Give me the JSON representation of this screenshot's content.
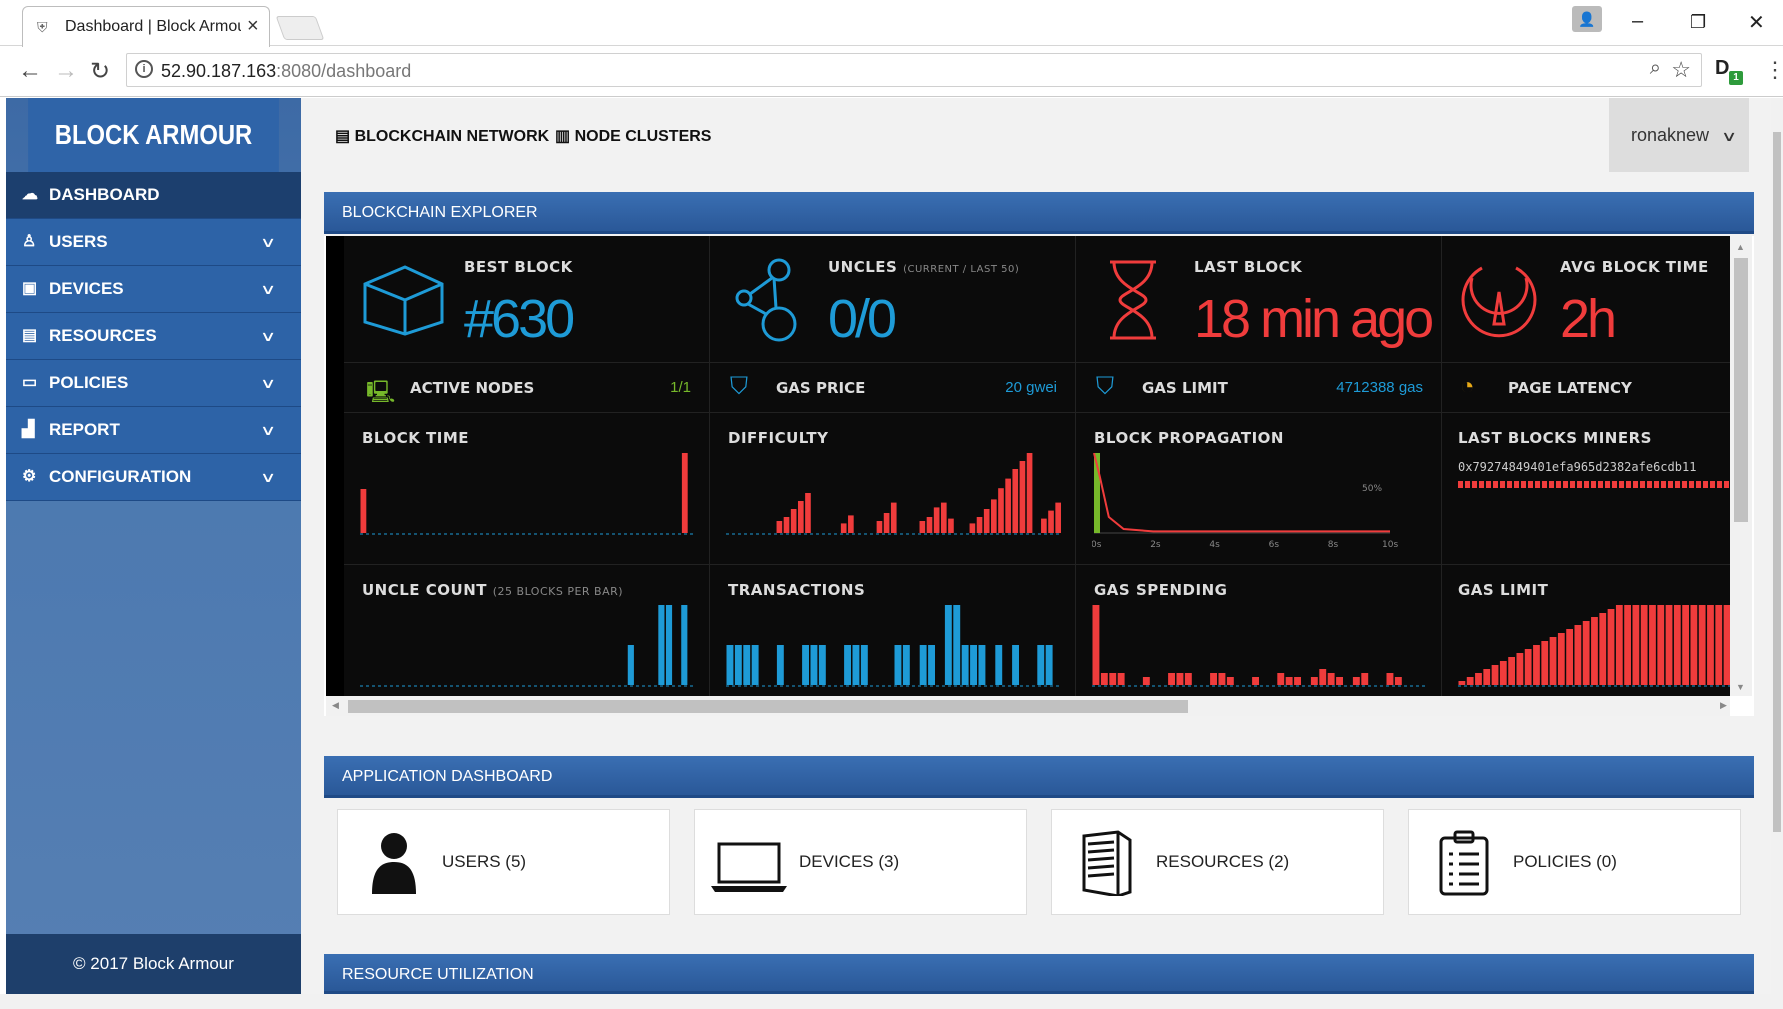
{
  "browser": {
    "tab_title": "Dashboard | Block Armour",
    "url_host": "52.90.187.163",
    "url_path": ":8080/dashboard",
    "ext_badge": "1"
  },
  "sidebar": {
    "logo": "BLOCK ARMOUR",
    "items": [
      {
        "label": "DASHBOARD",
        "icon": "dashboard-icon"
      },
      {
        "label": "USERS",
        "icon": "user-icon"
      },
      {
        "label": "DEVICES",
        "icon": "monitor-icon"
      },
      {
        "label": "RESOURCES",
        "icon": "server-icon"
      },
      {
        "label": "POLICIES",
        "icon": "policy-icon"
      },
      {
        "label": "REPORT",
        "icon": "bar-chart-icon"
      },
      {
        "label": "CONFIGURATION",
        "icon": "gear-icon"
      }
    ],
    "footer": "© 2017 Block Armour"
  },
  "topnav": {
    "blockchain_network": "BLOCKCHAIN NETWORK",
    "node_clusters": "NODE CLUSTERS",
    "username": "ronaknew"
  },
  "explorer": {
    "title": "BLOCKCHAIN EXPLORER",
    "best_block": {
      "label": "BEST BLOCK",
      "value": "#630"
    },
    "uncles": {
      "label": "UNCLES",
      "sub": "(CURRENT / LAST 50)",
      "value": "0/0"
    },
    "last_block": {
      "label": "LAST BLOCK",
      "value": "18 min ago"
    },
    "avg_block_time": {
      "label": "AVG BLOCK TIME",
      "value": "2h"
    },
    "active_nodes": {
      "label": "ACTIVE NODES",
      "value": "1/1"
    },
    "gas_price": {
      "label": "GAS PRICE",
      "value": "20 gwei"
    },
    "gas_limit_row": {
      "label": "GAS LIMIT",
      "value": "4712388 gas"
    },
    "page_latency": {
      "label": "PAGE LATENCY"
    },
    "charts": {
      "block_time": "BLOCK TIME",
      "difficulty": "DIFFICULTY",
      "block_propagation": "BLOCK PROPAGATION",
      "last_blocks_miners": "LAST BLOCKS MINERS",
      "miner_address": "0x79274849401efa965d2382afe6cdb11",
      "uncle_count": "UNCLE COUNT",
      "uncle_count_sub": "(25 BLOCKS PER BAR)",
      "transactions": "TRANSACTIONS",
      "gas_spending": "GAS SPENDING",
      "gas_limit": "GAS LIMIT",
      "prop_ticks": [
        "0s",
        "2s",
        "4s",
        "6s",
        "8s",
        "10s"
      ],
      "prop_pct": "50%"
    }
  },
  "chart_data": [
    {
      "type": "bar",
      "title": "BLOCK TIME",
      "values": [
        0.55,
        0,
        0,
        0,
        0,
        0,
        0,
        0,
        0,
        0,
        0,
        0,
        0,
        0,
        0,
        0,
        0,
        0,
        0,
        0,
        0,
        0,
        0,
        0,
        0,
        0,
        0,
        0,
        0,
        0,
        0,
        0,
        0,
        0,
        0,
        0,
        0,
        0,
        0,
        0,
        0,
        0,
        0,
        0,
        1.0,
        0
      ]
    },
    {
      "type": "bar",
      "title": "DIFFICULTY",
      "values": [
        0,
        0,
        0,
        0,
        0,
        0,
        0,
        0.15,
        0.2,
        0.3,
        0.4,
        0.5,
        0,
        0,
        0,
        0,
        0.12,
        0.22,
        0,
        0,
        0,
        0.15,
        0.25,
        0.38,
        0,
        0,
        0,
        0.15,
        0.2,
        0.32,
        0.38,
        0.18,
        0,
        0,
        0.12,
        0.2,
        0.3,
        0.42,
        0.56,
        0.68,
        0.8,
        0.9,
        1.0,
        0,
        0.18,
        0.28,
        0.38
      ]
    },
    {
      "type": "line",
      "title": "BLOCK PROPAGATION",
      "x": [
        0,
        0.2,
        0.5,
        1,
        2,
        4,
        6,
        8,
        10
      ],
      "y": [
        1.0,
        0.7,
        0.2,
        0.05,
        0.02,
        0.02,
        0.02,
        0.02,
        0.02
      ]
    },
    {
      "type": "bar",
      "title": "UNCLE COUNT",
      "values": [
        0,
        0,
        0,
        0,
        0,
        0,
        0,
        0,
        0,
        0,
        0,
        0,
        0,
        0,
        0,
        0,
        0,
        0,
        0,
        0,
        0,
        0,
        0,
        0,
        0,
        0,
        0,
        0,
        0,
        0,
        0,
        0,
        0,
        0,
        0,
        0.5,
        0,
        0,
        0,
        1.0,
        1.0,
        0,
        1.0,
        0
      ]
    },
    {
      "type": "bar",
      "title": "TRANSACTIONS",
      "values": [
        0.5,
        0.5,
        0.5,
        0.5,
        0,
        0,
        0.5,
        0,
        0,
        0.5,
        0.5,
        0.5,
        0,
        0,
        0.5,
        0.5,
        0.5,
        0,
        0,
        0,
        0.5,
        0.5,
        0,
        0.5,
        0.5,
        0,
        1.0,
        1.0,
        0.5,
        0.5,
        0.5,
        0,
        0.5,
        0,
        0.5,
        0,
        0,
        0.5,
        0.5,
        0
      ]
    },
    {
      "type": "bar",
      "title": "GAS SPENDING",
      "values": [
        1.0,
        0.15,
        0.15,
        0.15,
        0,
        0,
        0.1,
        0,
        0,
        0.15,
        0.15,
        0.15,
        0,
        0,
        0.15,
        0.15,
        0.1,
        0,
        0,
        0.1,
        0,
        0,
        0.15,
        0.1,
        0.1,
        0,
        0.1,
        0.2,
        0.15,
        0.1,
        0,
        0.1,
        0.15,
        0,
        0,
        0.15,
        0.1,
        0,
        0,
        0
      ]
    },
    {
      "type": "bar",
      "title": "GAS LIMIT",
      "values": [
        0.05,
        0.1,
        0.15,
        0.2,
        0.25,
        0.3,
        0.35,
        0.4,
        0.45,
        0.5,
        0.55,
        0.6,
        0.65,
        0.7,
        0.75,
        0.8,
        0.85,
        0.9,
        0.95,
        1.0,
        1.0,
        1.0,
        1.0,
        1.0,
        1.0,
        1.0,
        1.0,
        1.0,
        1.0,
        1.0,
        1.0,
        1.0,
        1.0,
        1.0,
        1.0
      ]
    }
  ],
  "app_dashboard": {
    "title": "APPLICATION DASHBOARD",
    "cards": [
      {
        "label": "USERS (5)",
        "icon": "person-icon"
      },
      {
        "label": "DEVICES (3)",
        "icon": "laptop-icon"
      },
      {
        "label": "RESOURCES (2)",
        "icon": "server-tower-icon"
      },
      {
        "label": "POLICIES (0)",
        "icon": "clipboard-icon"
      }
    ]
  },
  "resource_utilization": {
    "title": "RESOURCE UTILIZATION"
  },
  "colors": {
    "accent": "#2d63a7",
    "blue": "#1e9bd7",
    "red": "#f03c3c",
    "green": "#76b82a"
  }
}
